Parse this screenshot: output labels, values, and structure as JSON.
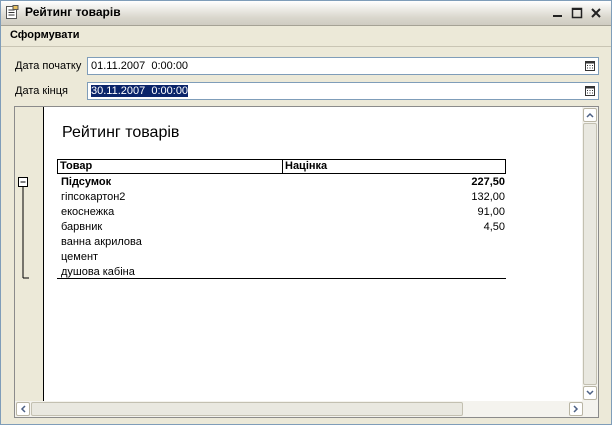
{
  "window": {
    "title": "Рейтинг товарів"
  },
  "toolbar": {
    "generate_label": "Сформувати"
  },
  "fields": {
    "start_label": "Дата початку",
    "start_value": "01.11.2007  0:00:00",
    "end_label": "Дата кінця",
    "end_value": "30.11.2007  0:00:00"
  },
  "report": {
    "title": "Рейтинг товарів",
    "columns": [
      "Товар",
      "Націнка"
    ],
    "total": {
      "label": "Підсумок",
      "value": "227,50"
    },
    "rows": [
      {
        "name": "гіпсокартон2",
        "value": "132,00"
      },
      {
        "name": "екоснежка",
        "value": "91,00"
      },
      {
        "name": "барвник",
        "value": "4,50"
      },
      {
        "name": "ванна акрилова",
        "value": ""
      },
      {
        "name": "цемент",
        "value": ""
      },
      {
        "name": "душова кабіна",
        "value": ""
      }
    ]
  }
}
